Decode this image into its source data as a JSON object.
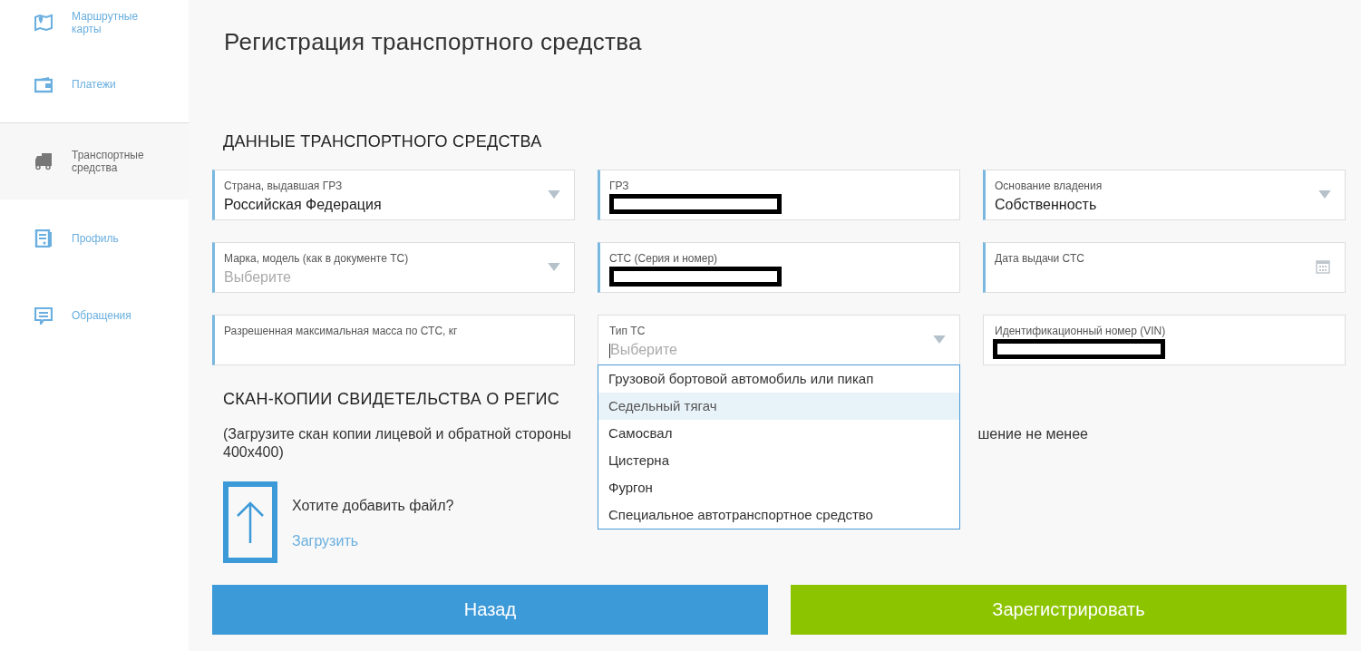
{
  "sidebar": {
    "items": [
      {
        "label": "Маршрутные карты",
        "kind": "map",
        "selected": false
      },
      {
        "label": "Платежи",
        "kind": "wallet",
        "selected": false
      },
      {
        "label": "Транспортные средства",
        "kind": "truck",
        "selected": true
      },
      {
        "label": "Профиль",
        "kind": "document",
        "selected": false
      },
      {
        "label": "Обращения",
        "kind": "chat",
        "selected": false
      }
    ]
  },
  "title": "Регистрация транспортного средства",
  "vehicle_section": {
    "heading": "ДАННЫЕ ТРАНСПОРТНОГО СРЕДСТВА",
    "fields": [
      {
        "label": "Страна, выдавшая ГРЗ",
        "value": "Российская Федерация",
        "kind": "select",
        "accent": true,
        "redacted": false
      },
      {
        "label": "ГРЗ",
        "kind": "text",
        "accent": true,
        "redacted": true
      },
      {
        "label": "Основание владения",
        "value": "Собственность",
        "kind": "select",
        "accent": true,
        "redacted": false
      },
      {
        "label": "Марка, модель (как в документе ТС)",
        "placeholder": "Выберите",
        "kind": "select",
        "accent": true,
        "redacted": false
      },
      {
        "label": "СТС (Серия и номер)",
        "kind": "text",
        "accent": true,
        "redacted": true
      },
      {
        "label": "Дата выдачи СТС",
        "kind": "date",
        "accent": true,
        "redacted": false
      },
      {
        "label": "Разрешенная максимальная масса по СТС, кг",
        "kind": "text",
        "accent": true,
        "redacted": false
      },
      {
        "label": "Тип ТС",
        "placeholder": "Выберите",
        "kind": "select",
        "accent": false,
        "redacted": false,
        "expanded": true,
        "options": [
          {
            "label": "Грузовой бортовой автомобиль или пикап",
            "selected": false
          },
          {
            "label": "Седельный тягач",
            "selected": true
          },
          {
            "label": "Самосвал",
            "selected": false
          },
          {
            "label": "Цистерна",
            "selected": false
          },
          {
            "label": "Фургон",
            "selected": false
          },
          {
            "label": "Специальное автотранспортное средство",
            "selected": false
          }
        ]
      },
      {
        "label": "Идентификационный номер (VIN)",
        "kind": "text",
        "accent": false,
        "redacted": true
      }
    ]
  },
  "scan_section": {
    "heading": "СКАН-КОПИИ СВИДЕТЕЛЬСТВА О РЕГИС",
    "description": [
      "(Загрузите скан копии лицевой и обратной стороны",
      "шение не менее",
      "400x400)"
    ],
    "upload_prompt": "Хотите добавить файл?",
    "upload_link": "Загрузить"
  },
  "buttons": [
    {
      "label": "Назад",
      "kind": "secondary"
    },
    {
      "label": "Зарегистрировать",
      "kind": "primary"
    }
  ]
}
